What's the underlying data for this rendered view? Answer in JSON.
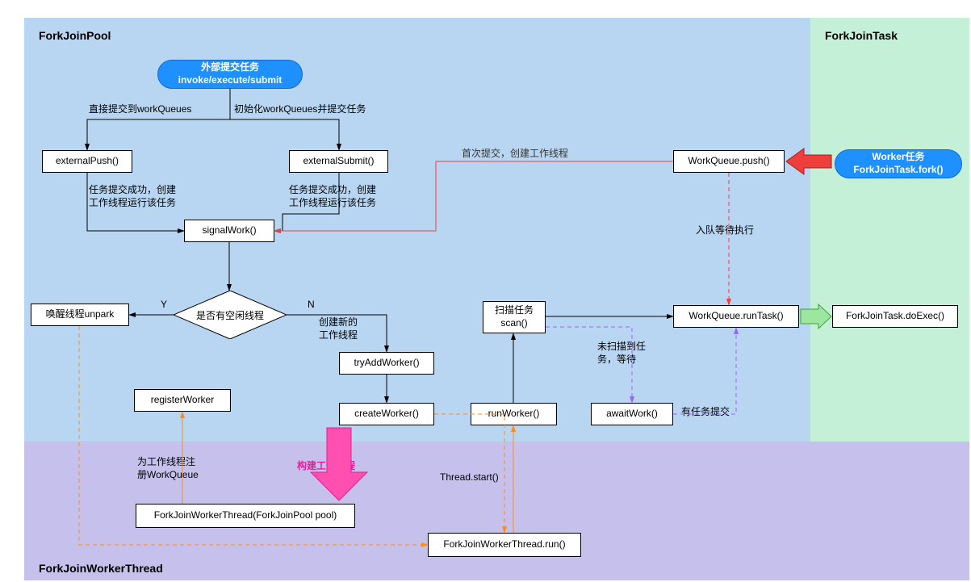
{
  "regions": {
    "pool_label": "ForkJoinPool",
    "task_label": "ForkJoinTask",
    "worker_label": "ForkJoinWorkerThread"
  },
  "nodes": {
    "submit_pill": {
      "line1": "外部提交任务",
      "line2": "invoke/execute/submit"
    },
    "externalPush": "externalPush()",
    "externalSubmit": "externalSubmit()",
    "signalWork": "signalWork()",
    "idleDecision": "是否有空闲线程",
    "unpark": "唤醒线程unpark",
    "tryAddWorker": "tryAddWorker()",
    "createWorker": "createWorker()",
    "registerWorker": "registerWorker",
    "fjwtCtor": "ForkJoinWorkerThread(ForkJoinPool pool)",
    "fjwtRun": "ForkJoinWorkerThread.run()",
    "runWorker": "runWorker()",
    "scan": {
      "line1": "扫描任务",
      "line2": "scan()"
    },
    "awaitWork": "awaitWork()",
    "wqRunTask": "WorkQueue.runTask()",
    "wqPush": "WorkQueue.push()",
    "doExec": "ForkJoinTask.doExec()",
    "workerFork": {
      "line1": "Worker任务",
      "line2": "ForkJoinTask.fork()"
    }
  },
  "labels": {
    "directSubmit": "直接提交到workQueues",
    "initAndSubmit": "初始化workQueues并提交任务",
    "pushOkCreateRun1": "任务提交成功，创建\n工作线程运行该任务",
    "pushOkCreateRun2": "任务提交成功，创建\n工作线程运行该任务",
    "firstSubmitCreate": "首次提交，创建工作线程",
    "enqueueWait": "入队等待执行",
    "Y": "Y",
    "N": "N",
    "createNewThread": "创建新的\n工作线程",
    "buildWorker": "构建工作线程",
    "regWorkQueue": "为工作线程注\n册WorkQueue",
    "threadStart": "Thread.start()",
    "noTaskWait": "未扫描到任\n务，等待",
    "hasTaskSubmit": "有任务提交"
  }
}
